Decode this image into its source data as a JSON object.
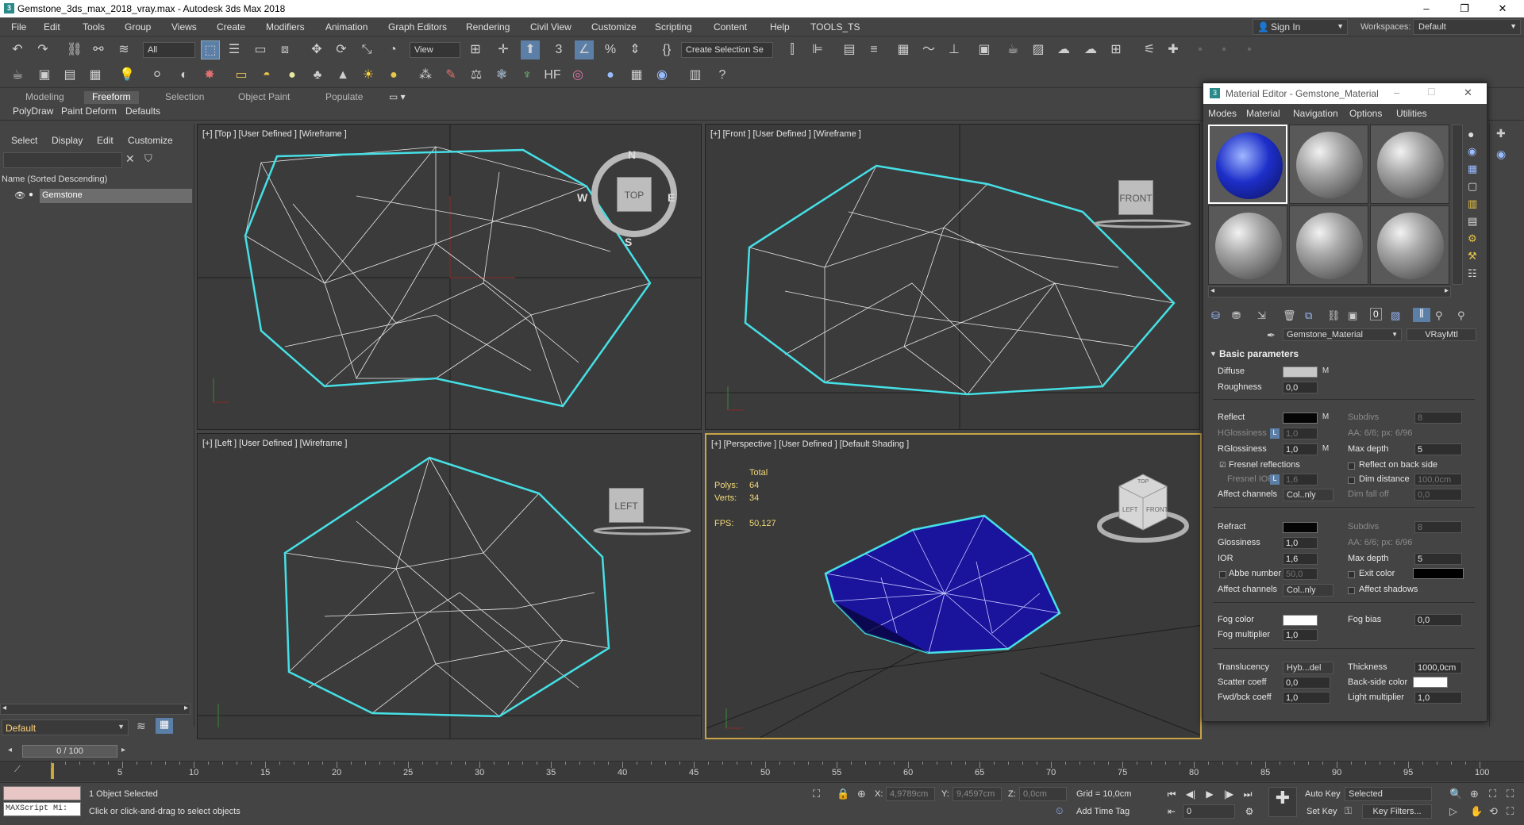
{
  "window": {
    "title": "Gemstone_3ds_max_2018_vray.max - Autodesk 3ds Max 2018",
    "minimize": "–",
    "restore": "❐",
    "close": "✕"
  },
  "menu": [
    "File",
    "Edit",
    "Tools",
    "Group",
    "Views",
    "Create",
    "Modifiers",
    "Animation",
    "Graph Editors",
    "Rendering",
    "Civil View",
    "Customize",
    "Scripting",
    "Content",
    "Help",
    "TOOLS_TS"
  ],
  "signin": "Sign In",
  "workspace": {
    "label": "Workspaces:",
    "value": "Default"
  },
  "toolbar": {
    "filter_all": "All",
    "ref_coord": "View",
    "create_selection": "Create Selection Se"
  },
  "ribbon": {
    "tabs": [
      "Modeling",
      "Freeform",
      "Selection",
      "Object Paint",
      "Populate"
    ],
    "active_tab": "Freeform",
    "subtabs": [
      "PolyDraw",
      "Paint Deform",
      "Defaults"
    ]
  },
  "explorer": {
    "tabs": [
      "Select",
      "Display",
      "Edit",
      "Customize"
    ],
    "column_header": "Name (Sorted Descending)",
    "objects": [
      "Gemstone"
    ],
    "layer": "Default"
  },
  "viewports": {
    "top": {
      "label": "[+] [Top ] [User Defined ] [Wireframe ]",
      "cube": "TOP",
      "compass": [
        "N",
        "W",
        "E",
        "S"
      ]
    },
    "front": {
      "label": "[+] [Front ] [User Defined ] [Wireframe ]",
      "cube": "FRONT"
    },
    "left": {
      "label": "[+] [Left ] [User Defined ] [Wireframe ]",
      "cube": "LEFT"
    },
    "perspective": {
      "label": "[+] [Perspective ] [User Defined ] [Default Shading ]",
      "stats": {
        "header": "Total",
        "polys_label": "Polys:",
        "polys": "64",
        "verts_label": "Verts:",
        "verts": "34",
        "fps_label": "FPS:",
        "fps": "50,127"
      },
      "cube_faces": [
        "TOP",
        "LEFT",
        "FRONT"
      ]
    }
  },
  "material_editor": {
    "title": "Material Editor - Gemstone_Material",
    "menu": [
      "Modes",
      "Material",
      "Navigation",
      "Options",
      "Utilities"
    ],
    "material_name": "Gemstone_Material",
    "material_type": "VRayMtl",
    "section": "Basic parameters",
    "diffuse": {
      "label": "Diffuse",
      "color": "#c8c8c8"
    },
    "roughness": {
      "label": "Roughness",
      "value": "0,0"
    },
    "reflect": {
      "label": "Reflect",
      "color": "#050505"
    },
    "hglossiness": {
      "label": "HGlossiness",
      "value": "1,0"
    },
    "rglossiness": {
      "label": "RGlossiness",
      "value": "1,0"
    },
    "subdivs_reflect": {
      "label": "Subdivs",
      "value": "8"
    },
    "aa_reflect": "AA: 6/6; px: 6/96",
    "max_depth_reflect": {
      "label": "Max depth",
      "value": "5"
    },
    "fresnel": "Fresnel reflections",
    "fresnel_ior": {
      "label": "Fresnel IOR",
      "value": "1,6"
    },
    "reflect_backside": "Reflect on back side",
    "dim_distance": {
      "label": "Dim distance",
      "value": "100,0cm"
    },
    "dim_falloff": {
      "label": "Dim fall off",
      "value": "0,0"
    },
    "affect_channels_1": {
      "label": "Affect channels",
      "value": "Col..nly"
    },
    "refract": {
      "label": "Refract",
      "color": "#050505"
    },
    "subdivs_refract": {
      "label": "Subdivs",
      "value": "8"
    },
    "glossiness": {
      "label": "Glossiness",
      "value": "1,0"
    },
    "aa_refract": "AA: 6/6; px: 6/96",
    "ior": {
      "label": "IOR",
      "value": "1,6"
    },
    "max_depth_refract": {
      "label": "Max depth",
      "value": "5"
    },
    "abbe": {
      "label": "Abbe number",
      "value": "50,0"
    },
    "exit_color": {
      "label": "Exit color",
      "color": "#000000"
    },
    "affect_channels_2": {
      "label": "Affect channels",
      "value": "Col..nly"
    },
    "affect_shadows": "Affect shadows",
    "fog_color": {
      "label": "Fog color",
      "color": "#ffffff"
    },
    "fog_bias": {
      "label": "Fog bias",
      "value": "0,0"
    },
    "fog_multiplier": {
      "label": "Fog multiplier",
      "value": "1,0"
    },
    "translucency": {
      "label": "Translucency",
      "value": "Hyb...del"
    },
    "thickness": {
      "label": "Thickness",
      "value": "1000,0cm"
    },
    "scatter": {
      "label": "Scatter coeff",
      "value": "0,0"
    },
    "backside_color": {
      "label": "Back-side color",
      "color": "#ffffff"
    },
    "fwdbck": {
      "label": "Fwd/bck coeff",
      "value": "1,0"
    },
    "light_mult": {
      "label": "Light multiplier",
      "value": "1,0"
    },
    "m": "M",
    "l": "L"
  },
  "timeline": {
    "frame": "0 / 100",
    "ticks": [
      "5",
      "10",
      "15",
      "20",
      "25",
      "30",
      "35",
      "40",
      "45",
      "50",
      "55",
      "60",
      "65",
      "70",
      "75",
      "80",
      "85",
      "90",
      "95",
      "100"
    ]
  },
  "status": {
    "maxscript": "MAXScript Mi:",
    "selected": "1 Object Selected",
    "prompt": "Click or click-and-drag to select objects",
    "x_label": "X:",
    "x": "4,9789cm",
    "y_label": "Y:",
    "y": "9,4597cm",
    "z_label": "Z:",
    "z": "0,0cm",
    "grid": "Grid = 10,0cm",
    "add_time_tag": "Add Time Tag",
    "auto_key": "Auto Key",
    "set_key": "Set Key",
    "selected_set": "Selected",
    "key_filters": "Key Filters...",
    "frame_field": "0"
  }
}
